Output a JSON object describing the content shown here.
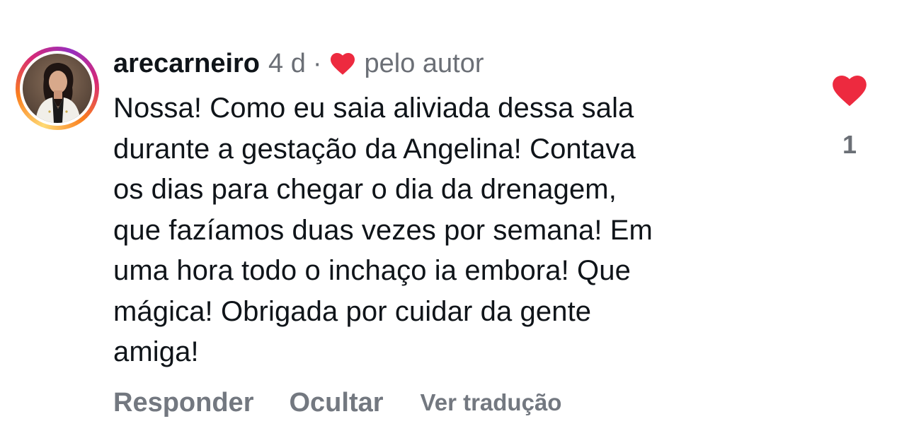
{
  "comment": {
    "username": "arecarneiro",
    "time_ago": "4 d",
    "separator": "·",
    "liked_by_author_label": "pelo autor",
    "text_lines": [
      "Nossa! Como eu saia aliviada dessa sala",
      "durante a gestação da Angelina! Contava",
      "os dias para chegar o dia da drenagem,",
      "que fazíamos duas vezes por semana! Em",
      "uma hora todo o inchaço ia embora! Que",
      "mágica! Obrigada por cuidar da gente",
      "amiga!"
    ],
    "like_count": "1",
    "icons": {
      "author_like": "heart-icon",
      "like_button": "heart-icon"
    },
    "colors": {
      "heart": "#ed2a3f",
      "muted_text": "#6b6f76",
      "action_text": "#737880"
    }
  },
  "actions": {
    "reply_label": "Responder",
    "hide_label": "Ocultar",
    "translate_label": "Ver tradução"
  }
}
